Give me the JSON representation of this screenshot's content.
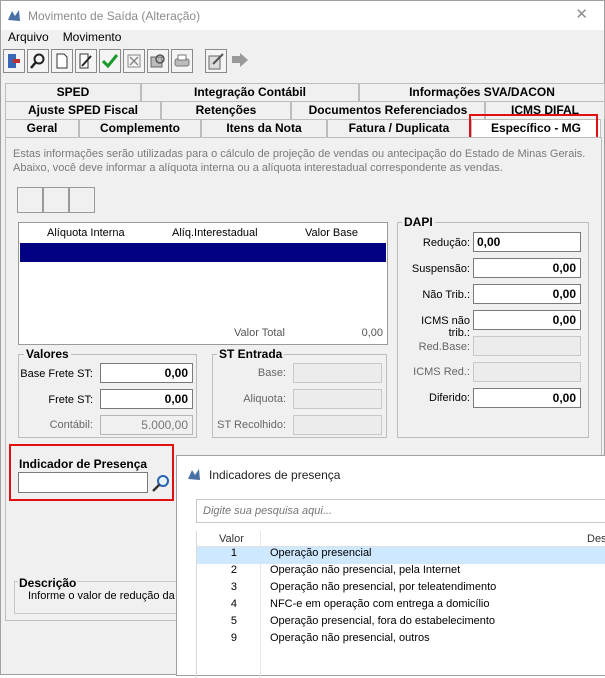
{
  "window": {
    "title": "Movimento de Saída (Alteração)",
    "close_glyph": "✕"
  },
  "menu": [
    "Arquivo",
    "Movimento"
  ],
  "toolbar": [
    "exit-icon",
    "search-icon",
    "new-icon",
    "edit-icon",
    "confirm-icon",
    "cancel-icon",
    "refresh-icon",
    "print-icon",
    "iss-icon",
    "next-icon"
  ],
  "tabs": {
    "row1": [
      "SPED",
      "Integração Contábil",
      "Informações SVA/DACON"
    ],
    "row2": [
      "Ajuste SPED Fiscal",
      "Retenções",
      "Documentos Referenciados",
      "ICMS DIFAL"
    ],
    "row3": [
      "Geral",
      "Complemento",
      "Itens da Nota",
      "Fatura / Duplicata",
      "Específico - MG"
    ]
  },
  "info_text": "Estas informações serão utilizadas para o cálculo de projeção de vendas ou antecipação do Estado de Minas Gerais. Abaixo, você deve informar a alíquota interna ou a alíquota interestadual correspondente as vendas.",
  "grid": {
    "columns": [
      "Alíquota Interna",
      "Alíq.Interestadual",
      "Valor Base"
    ],
    "total_label": "Valor Total",
    "total_value": "0,00"
  },
  "valores": {
    "title": "Valores",
    "base_frete_label": "Base Frete ST:",
    "base_frete_value": "0,00",
    "frete_st_label": "Frete ST:",
    "frete_st_value": "0,00",
    "contabil_label": "Contábil:",
    "contabil_value": "5.000,00"
  },
  "st_entrada": {
    "title": "ST Entrada",
    "base_label": "Base:",
    "aliquota_label": "Aliquota:",
    "recolhido_label": "ST Recolhido:"
  },
  "dapi": {
    "title": "DAPI",
    "reducao_label": "Redução:",
    "reducao_value": "0,00",
    "suspensao_label": "Suspensão:",
    "suspensao_value": "0,00",
    "nao_trib_label": "Não Trib.:",
    "nao_trib_value": "0,00",
    "icms_nao_trib_label": "ICMS não trib.:",
    "icms_nao_trib_value": "0,00",
    "red_base_label": "Red.Base:",
    "icms_red_label": "ICMS Red.:",
    "diferido_label": "Diferido:",
    "diferido_value": "0,00"
  },
  "indicador": {
    "title": "Indicador de Presença",
    "value": ""
  },
  "descricao": {
    "title": "Descrição",
    "text": "Informe o valor de redução da b"
  },
  "popup": {
    "title": "Indicadores de presença",
    "search_placeholder": "Digite sua pesquisa aqui...",
    "col_valor": "Valor",
    "col_desc": "Desc",
    "rows": [
      {
        "valor": "1",
        "desc": "Operação presencial"
      },
      {
        "valor": "2",
        "desc": "Operação não presencial, pela Internet"
      },
      {
        "valor": "3",
        "desc": "Operação não presencial, por teleatendimento"
      },
      {
        "valor": "4",
        "desc": "NFC-e em operação com entrega a domicílio"
      },
      {
        "valor": "5",
        "desc": "Operação presencial, fora do estabelecimento"
      },
      {
        "valor": "9",
        "desc": "Operação não presencial, outros"
      }
    ]
  },
  "colors": {
    "selection": "#000080",
    "highlight": "#e01010",
    "popup_selection": "#cde8ff"
  }
}
